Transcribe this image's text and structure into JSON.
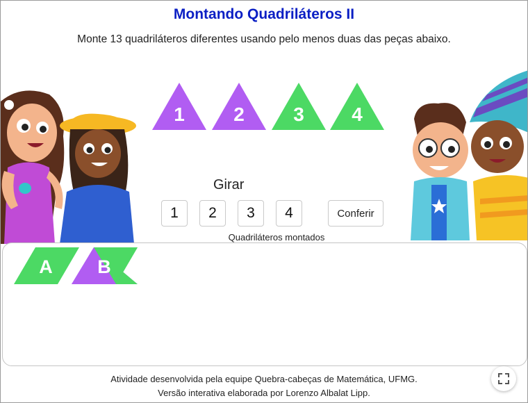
{
  "header": {
    "title": "Montando Quadriláteros II",
    "instruction": "Monte 13 quadriláteros diferentes usando pelo menos duas das peças abaixo."
  },
  "pieces": [
    {
      "label": "1",
      "color": "#b15df2"
    },
    {
      "label": "2",
      "color": "#b15df2"
    },
    {
      "label": "3",
      "color": "#4cd964"
    },
    {
      "label": "4",
      "color": "#4cd964"
    }
  ],
  "controls": {
    "rotate_label": "Girar",
    "rotate_buttons": [
      "1",
      "2",
      "3",
      "4"
    ],
    "check_label": "Conferir"
  },
  "assembled": {
    "label": "Quadriláteros montados",
    "shapes": [
      {
        "label": "A",
        "colors": [
          "#4cd964",
          "#4cd964"
        ]
      },
      {
        "label": "B",
        "colors": [
          "#b15df2",
          "#4cd964"
        ]
      }
    ]
  },
  "footer": {
    "line1": "Atividade desenvolvida pela equipe Quebra-cabeças de Matemática, UFMG.",
    "line2": "Versão interativa elaborada por Lorenzo Albalat Lipp."
  },
  "icons": {
    "fullscreen": "fullscreen-icon"
  }
}
